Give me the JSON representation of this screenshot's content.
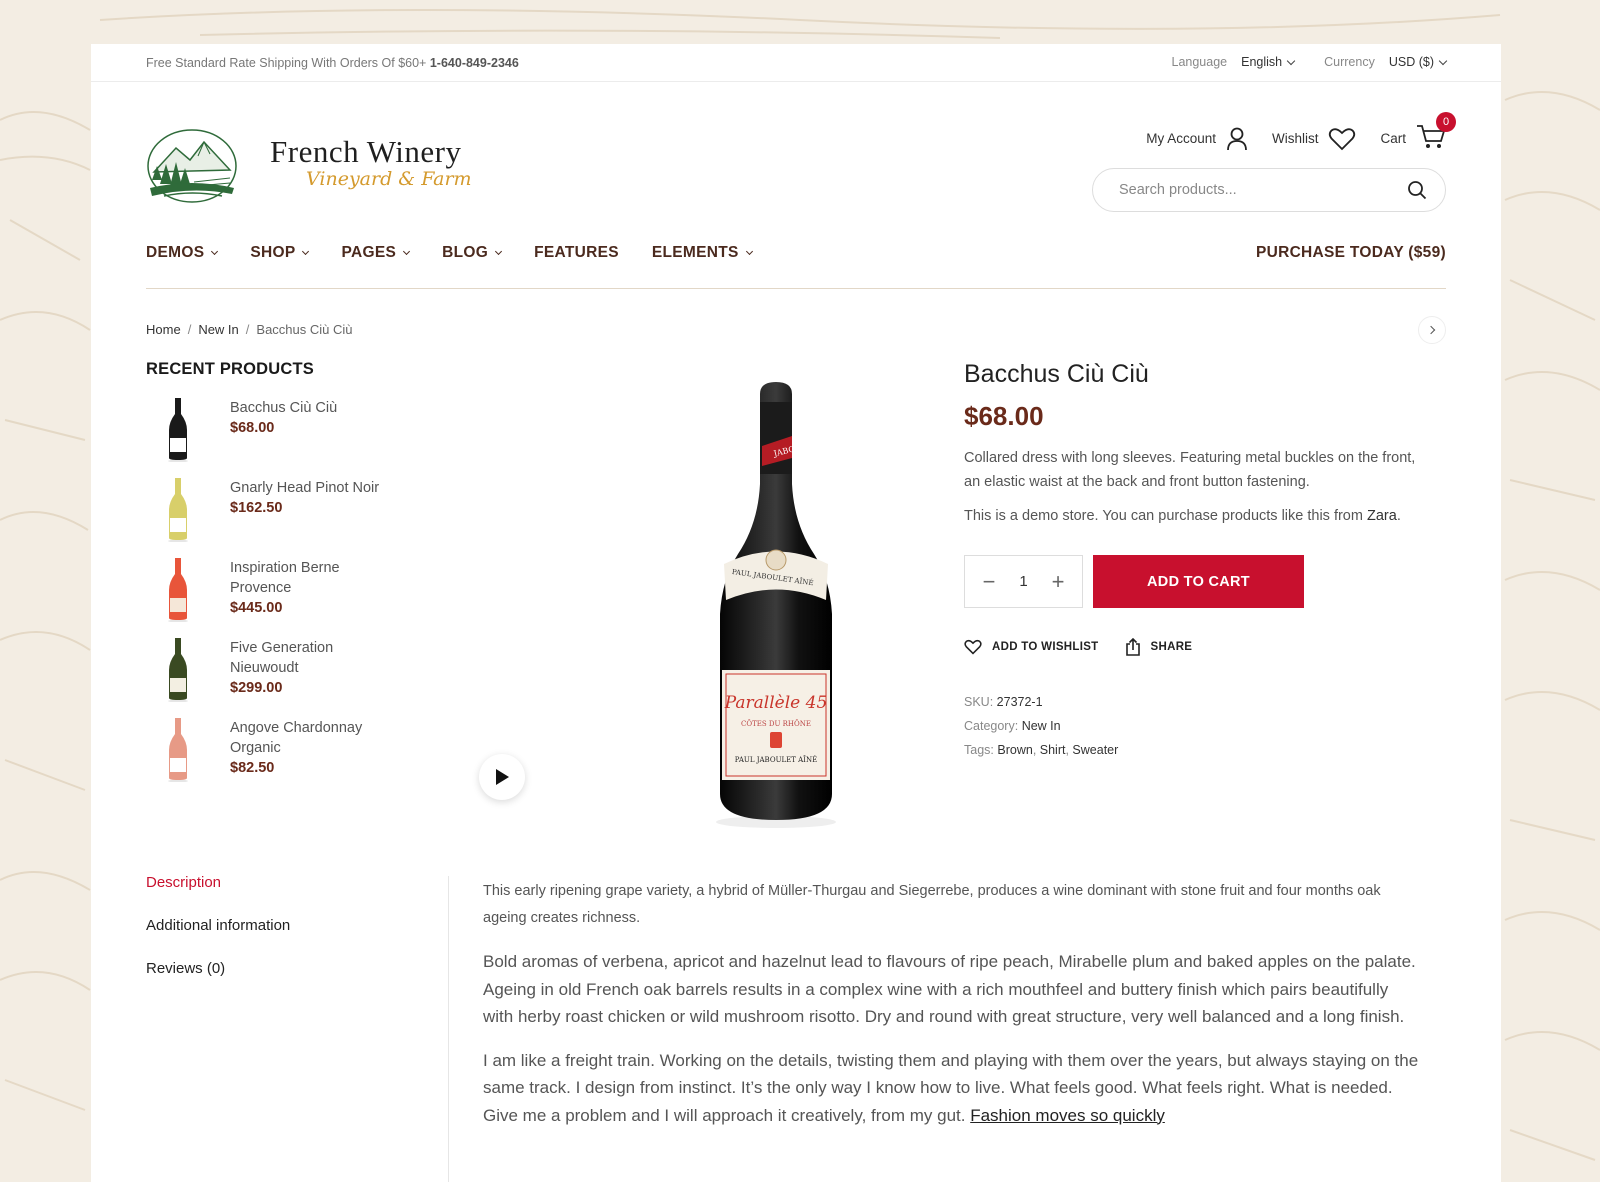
{
  "topbar": {
    "shipping_text": "Free Standard Rate Shipping With Orders Of $60+",
    "phone": "1-640-849-2346",
    "language_label": "Language",
    "language_value": "English",
    "currency_label": "Currency",
    "currency_value": "USD ($)"
  },
  "logo": {
    "title": "French Winery",
    "subtitle": "Vineyard & Farm"
  },
  "header": {
    "account_label": "My Account",
    "wishlist_label": "Wishlist",
    "cart_label": "Cart",
    "cart_count": "0",
    "search_placeholder": "Search products..."
  },
  "nav": {
    "items": [
      {
        "label": "DEMOS"
      },
      {
        "label": "SHOP"
      },
      {
        "label": "PAGES"
      },
      {
        "label": "BLOG"
      },
      {
        "label": "FEATURES"
      },
      {
        "label": "ELEMENTS"
      }
    ],
    "cta": "PURCHASE TODAY ($59)"
  },
  "breadcrumb": {
    "home": "Home",
    "sep": "/",
    "category": "New In",
    "current": "Bacchus Ciù Ciù"
  },
  "recent": {
    "title": "RECENT PRODUCTS",
    "items": [
      {
        "name": "Bacchus Ciù Ciù",
        "price": "$68.00",
        "color": "#1a1a1a",
        "label": "#ffffff"
      },
      {
        "name": "Gnarly Head Pinot Noir",
        "price": "$162.50",
        "color": "#d8cf6a",
        "label": "#ffffff"
      },
      {
        "name": "Inspiration Berne Provence",
        "price": "$445.00",
        "color": "#e8553a",
        "label": "#f5e7d8"
      },
      {
        "name": "Five Generation Nieuwoudt",
        "price": "$299.00",
        "color": "#3a4a22",
        "label": "#f3efe2"
      },
      {
        "name": "Angove Chardonnay Organic",
        "price": "$82.50",
        "color": "#e79a86",
        "label": "#ffffff"
      }
    ]
  },
  "product": {
    "title": "Bacchus Ciù Ciù",
    "price": "$68.00",
    "desc1": "Collared dress with long sleeves. Featuring metal buckles on the front, an elastic waist at the back and front button fastening.",
    "desc2_prefix": "This is a demo store. You can purchase products like this from ",
    "desc2_link": "Zara",
    "desc2_suffix": ".",
    "qty": "1",
    "qty_minus": "−",
    "qty_plus": "+",
    "add_to_cart": "ADD TO CART",
    "wishlist": "ADD TO WISHLIST",
    "share": "SHARE",
    "sku_label": "SKU:",
    "sku": "27372-1",
    "category_label": "Category:",
    "category": "New In",
    "tags_label": "Tags:",
    "tags": [
      "Brown",
      "Shirt",
      "Sweater"
    ],
    "tag_sep": ", ",
    "bottle_label_top": "JABOULET",
    "bottle_label_script": "Parallèle 45",
    "bottle_label_region": "CÔTES DU RHÔNE",
    "bottle_label_maker": "PAUL JABOULET AÎNÉ",
    "bottle_neck_text": "PAUL JABOULET AÎNÉ"
  },
  "tabs": {
    "items": [
      {
        "label": "Description",
        "active": true
      },
      {
        "label": "Additional information",
        "active": false
      },
      {
        "label": "Reviews (0)",
        "active": false
      }
    ]
  },
  "description": {
    "p1": "This early ripening grape variety, a hybrid of Müller-Thurgau and Siegerrebe, produces a wine dominant with stone fruit and four months oak ageing creates richness.",
    "p2": "Bold aromas of verbena, apricot and hazelnut lead to flavours of ripe peach, Mirabelle plum and baked apples on the palate. Ageing in old French oak barrels results in a complex wine with a rich mouthfeel and buttery finish which pairs beautifully with herby roast chicken or wild mushroom risotto. Dry and round with great structure, very well balanced and a long finish.",
    "p3_text": "I am like a freight train. Working on the details, twisting them and playing with them over the years, but always staying on the same track. I design from instinct. It’s the only way I know how to live. What feels good. What feels right. What is needed. Give me a problem and I will approach it creatively, from my gut. ",
    "p3_link": "Fashion moves so quickly"
  },
  "colors": {
    "accent": "#c8102e",
    "brand_brown": "#4b2a1e",
    "price": "#6a2a1a",
    "background": "#f3ede3"
  }
}
